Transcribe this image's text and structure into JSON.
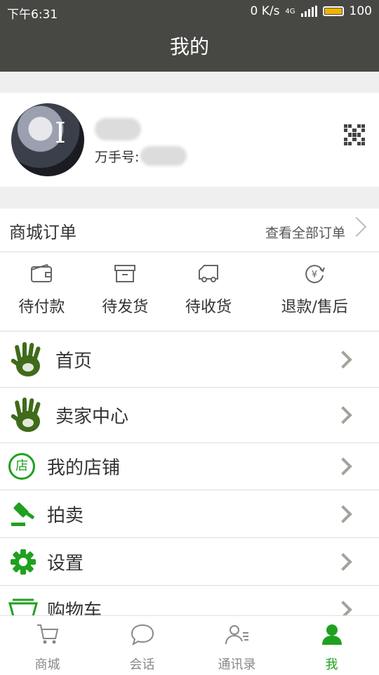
{
  "status_bar": {
    "time": "下午6:31",
    "net_speed": "0 K/s",
    "network": "4G",
    "battery": "100",
    "battery_level": 1.0,
    "battery_color": "#f0b400"
  },
  "title": "我的",
  "profile": {
    "id_label": "万手号:"
  },
  "orders": {
    "title": "商城订单",
    "view_all": "查看全部订单",
    "statuses": [
      {
        "label": "待付款",
        "icon": "wallet-icon"
      },
      {
        "label": "待发货",
        "icon": "box-icon"
      },
      {
        "label": "待收货",
        "icon": "truck-icon"
      },
      {
        "label": "退款/售后",
        "icon": "yuan-refund-icon"
      }
    ]
  },
  "menu": [
    {
      "label": "首页",
      "icon": "handprint-icon"
    },
    {
      "label": "卖家中心",
      "icon": "handprint-icon"
    },
    {
      "label": "我的店铺",
      "icon": "shop-badge-icon",
      "badge": "店"
    },
    {
      "label": "拍卖",
      "icon": "gavel-icon"
    },
    {
      "label": "设置",
      "icon": "gear-icon"
    },
    {
      "label": "购物车",
      "icon": "basket-icon"
    }
  ],
  "tabbar": [
    {
      "label": "商城",
      "icon": "cart-icon"
    },
    {
      "label": "会话",
      "icon": "chat-bubble-icon"
    },
    {
      "label": "通讯录",
      "icon": "contacts-icon"
    },
    {
      "label": "我",
      "icon": "person-icon",
      "active": true
    }
  ],
  "colors": {
    "header": "#474744",
    "accent_green": "#1fa11f",
    "hand_green": "#3f6b1a"
  }
}
